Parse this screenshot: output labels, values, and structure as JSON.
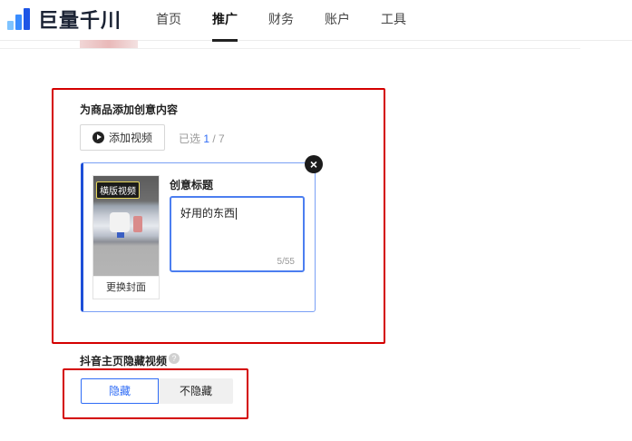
{
  "brand": {
    "name": "巨量千川"
  },
  "nav": {
    "items": [
      {
        "label": "首页",
        "active": false
      },
      {
        "label": "推广",
        "active": true
      },
      {
        "label": "财务",
        "active": false
      },
      {
        "label": "账户",
        "active": false
      },
      {
        "label": "工具",
        "active": false
      }
    ]
  },
  "creative": {
    "section_title": "为商品添加创意内容",
    "add_video_label": "添加视频",
    "selected_prefix": "已选",
    "selected_count": "1",
    "selected_total": "/ 7",
    "card": {
      "badge": "横版视频",
      "change_cover_label": "更换封面",
      "title_label": "创意标题",
      "title_value": "好用的东西",
      "char_counter": "5/55",
      "close_symbol": "×"
    }
  },
  "hide_video": {
    "label": "抖音主页隐藏视频",
    "help_symbol": "?",
    "options": [
      {
        "label": "隐藏",
        "selected": true
      },
      {
        "label": "不隐藏",
        "selected": false
      }
    ]
  },
  "colors": {
    "accent": "#2f6cf6",
    "highlight_red": "#d40000"
  }
}
